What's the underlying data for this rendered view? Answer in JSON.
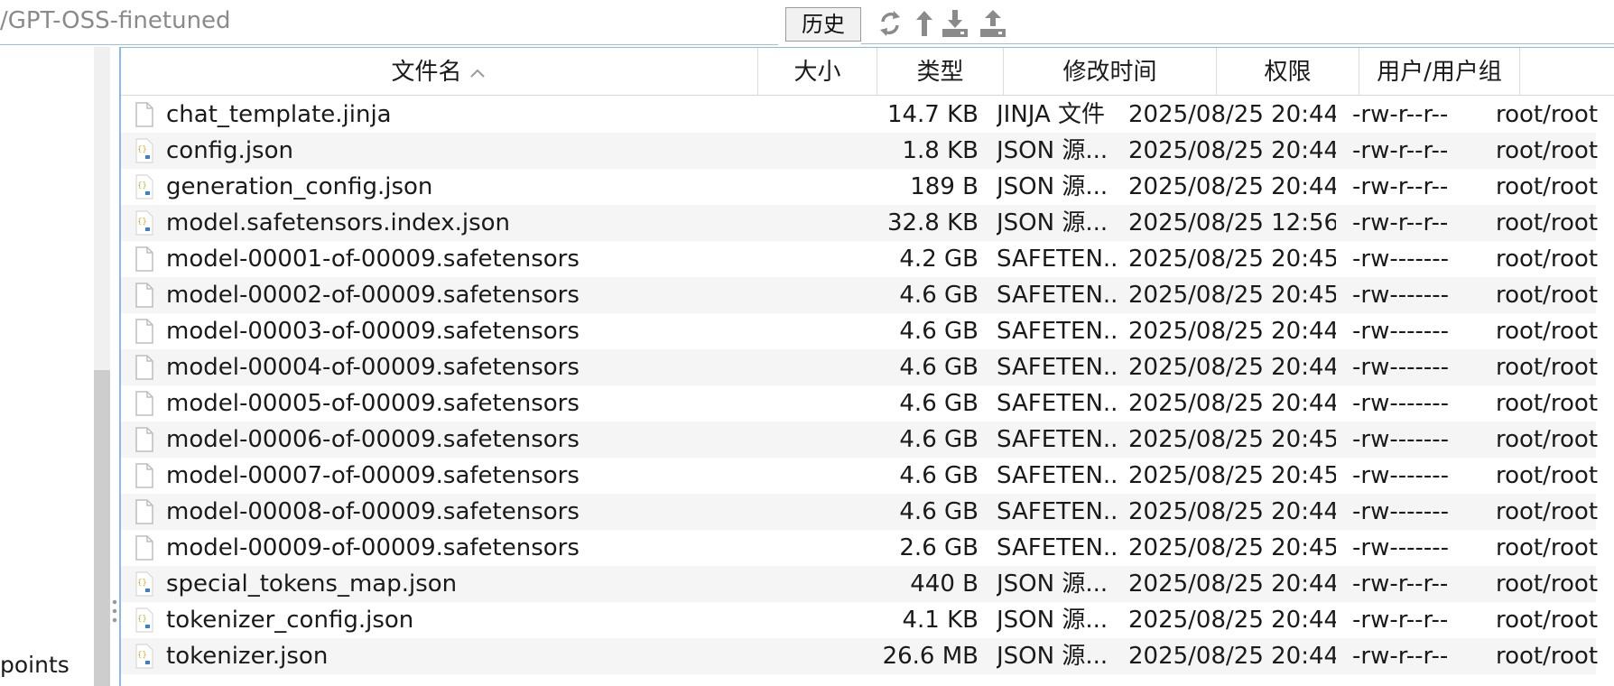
{
  "toolbar": {
    "path": "/GPT-OSS-finetuned",
    "history_label": "历史",
    "icons": [
      "refresh-icon",
      "up-directory-icon",
      "download-icon",
      "upload-icon"
    ]
  },
  "left_pane": {
    "visible_text": "points"
  },
  "file_table": {
    "headers": {
      "name": "文件名",
      "size": "大小",
      "type": "类型",
      "modified": "修改时间",
      "permissions": "权限",
      "owner": "用户/用户组"
    },
    "sort": {
      "column": "name",
      "direction": "ascending"
    },
    "rows": [
      {
        "name": "chat_template.jinja",
        "size": "14.7 KB",
        "type": "JINJA 文件",
        "modified": "2025/08/25 20:44",
        "permissions": "-rw-r--r--",
        "owner": "root/root",
        "icon": "file-icon"
      },
      {
        "name": "config.json",
        "size": "1.8 KB",
        "type": "JSON 源...",
        "modified": "2025/08/25 20:44",
        "permissions": "-rw-r--r--",
        "owner": "root/root",
        "icon": "json-file-icon"
      },
      {
        "name": "generation_config.json",
        "size": "189 B",
        "type": "JSON 源...",
        "modified": "2025/08/25 20:44",
        "permissions": "-rw-r--r--",
        "owner": "root/root",
        "icon": "json-file-icon"
      },
      {
        "name": "model.safetensors.index.json",
        "size": "32.8 KB",
        "type": "JSON 源...",
        "modified": "2025/08/25 12:56",
        "permissions": "-rw-r--r--",
        "owner": "root/root",
        "icon": "json-file-icon"
      },
      {
        "name": "model-00001-of-00009.safetensors",
        "size": "4.2 GB",
        "type": "SAFETEN...",
        "modified": "2025/08/25 20:45",
        "permissions": "-rw-------",
        "owner": "root/root",
        "icon": "file-icon"
      },
      {
        "name": "model-00002-of-00009.safetensors",
        "size": "4.6 GB",
        "type": "SAFETEN...",
        "modified": "2025/08/25 20:45",
        "permissions": "-rw-------",
        "owner": "root/root",
        "icon": "file-icon"
      },
      {
        "name": "model-00003-of-00009.safetensors",
        "size": "4.6 GB",
        "type": "SAFETEN...",
        "modified": "2025/08/25 20:44",
        "permissions": "-rw-------",
        "owner": "root/root",
        "icon": "file-icon"
      },
      {
        "name": "model-00004-of-00009.safetensors",
        "size": "4.6 GB",
        "type": "SAFETEN...",
        "modified": "2025/08/25 20:44",
        "permissions": "-rw-------",
        "owner": "root/root",
        "icon": "file-icon"
      },
      {
        "name": "model-00005-of-00009.safetensors",
        "size": "4.6 GB",
        "type": "SAFETEN...",
        "modified": "2025/08/25 20:44",
        "permissions": "-rw-------",
        "owner": "root/root",
        "icon": "file-icon"
      },
      {
        "name": "model-00006-of-00009.safetensors",
        "size": "4.6 GB",
        "type": "SAFETEN...",
        "modified": "2025/08/25 20:45",
        "permissions": "-rw-------",
        "owner": "root/root",
        "icon": "file-icon"
      },
      {
        "name": "model-00007-of-00009.safetensors",
        "size": "4.6 GB",
        "type": "SAFETEN...",
        "modified": "2025/08/25 20:45",
        "permissions": "-rw-------",
        "owner": "root/root",
        "icon": "file-icon"
      },
      {
        "name": "model-00008-of-00009.safetensors",
        "size": "4.6 GB",
        "type": "SAFETEN...",
        "modified": "2025/08/25 20:44",
        "permissions": "-rw-------",
        "owner": "root/root",
        "icon": "file-icon"
      },
      {
        "name": "model-00009-of-00009.safetensors",
        "size": "2.6 GB",
        "type": "SAFETEN...",
        "modified": "2025/08/25 20:45",
        "permissions": "-rw-------",
        "owner": "root/root",
        "icon": "file-icon"
      },
      {
        "name": "special_tokens_map.json",
        "size": "440 B",
        "type": "JSON 源...",
        "modified": "2025/08/25 20:44",
        "permissions": "-rw-r--r--",
        "owner": "root/root",
        "icon": "json-file-icon"
      },
      {
        "name": "tokenizer_config.json",
        "size": "4.1 KB",
        "type": "JSON 源...",
        "modified": "2025/08/25 20:44",
        "permissions": "-rw-r--r--",
        "owner": "root/root",
        "icon": "json-file-icon"
      },
      {
        "name": "tokenizer.json",
        "size": "26.6 MB",
        "type": "JSON 源...",
        "modified": "2025/08/25 20:44",
        "permissions": "-rw-r--r--",
        "owner": "root/root",
        "icon": "json-file-icon"
      }
    ]
  },
  "colors": {
    "accent_border": "#8db8e0",
    "row_alt": "#f5f5f5",
    "icon_gray": "#8a8a8a",
    "json_icon_green": "#c9b23a",
    "json_icon_blue": "#3a7fd0"
  }
}
